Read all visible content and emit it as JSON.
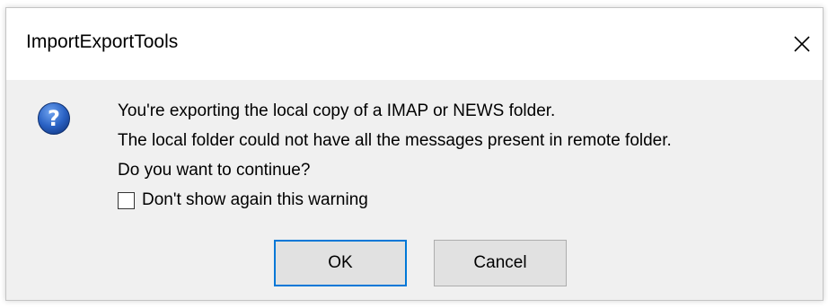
{
  "window": {
    "title": "ImportExportTools",
    "close_icon": "close-icon"
  },
  "message": {
    "icon": "question-icon",
    "lines": [
      "You're exporting the local copy of a IMAP or NEWS folder.",
      "The local folder could not have all the messages present in remote folder.",
      "Do you want to continue?"
    ]
  },
  "checkbox": {
    "label": "Don't show again this warning",
    "checked": false
  },
  "buttons": {
    "ok_label": "OK",
    "cancel_label": "Cancel"
  },
  "colors": {
    "default_button_border": "#0078d7",
    "question_icon": "#1d55b4"
  }
}
